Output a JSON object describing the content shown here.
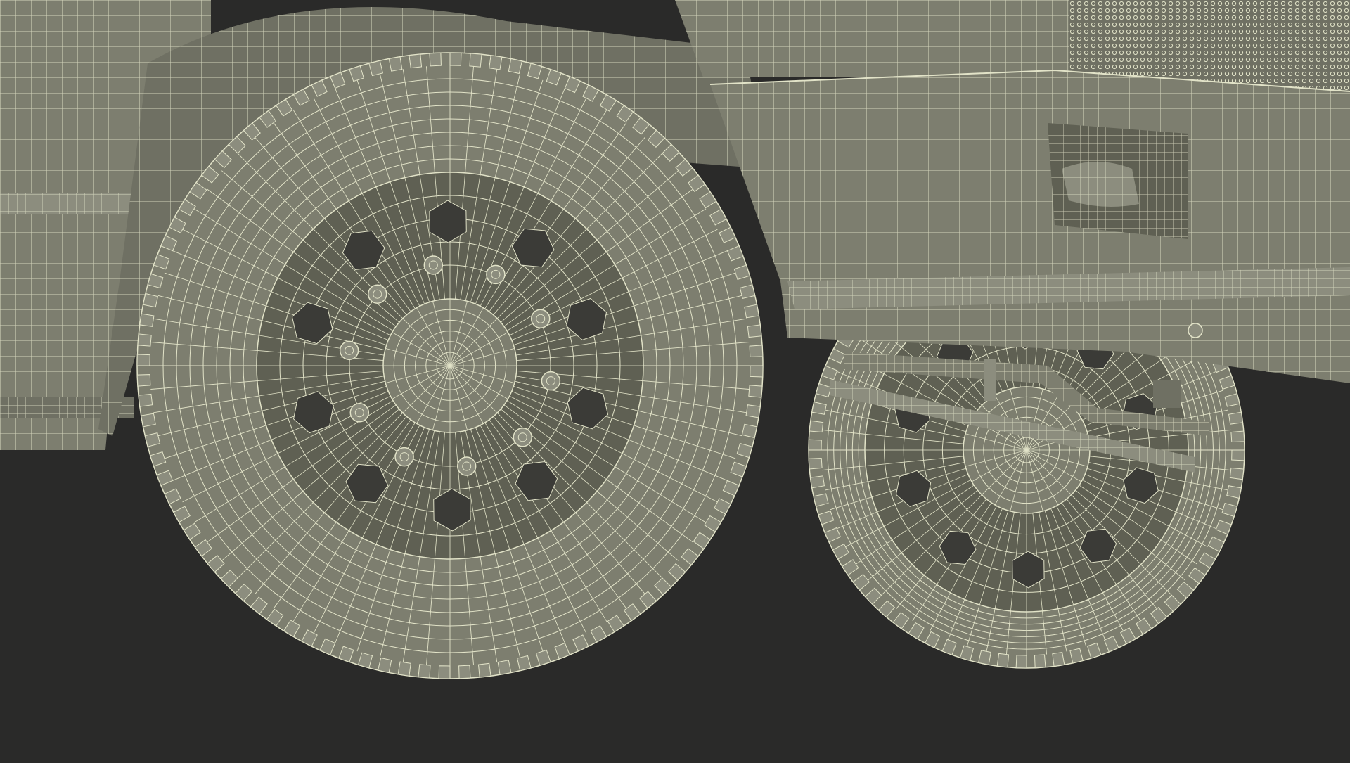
{
  "scene": {
    "subject": "truck-front-wheels-wireframe-render",
    "colors": {
      "background": "#2a2a29",
      "surface": "#7d7e6f",
      "surface_dark": "#5f6053",
      "surface_light": "#8c8d7e",
      "wire": "#e2e3c8",
      "hole": "#3b3b37"
    }
  }
}
